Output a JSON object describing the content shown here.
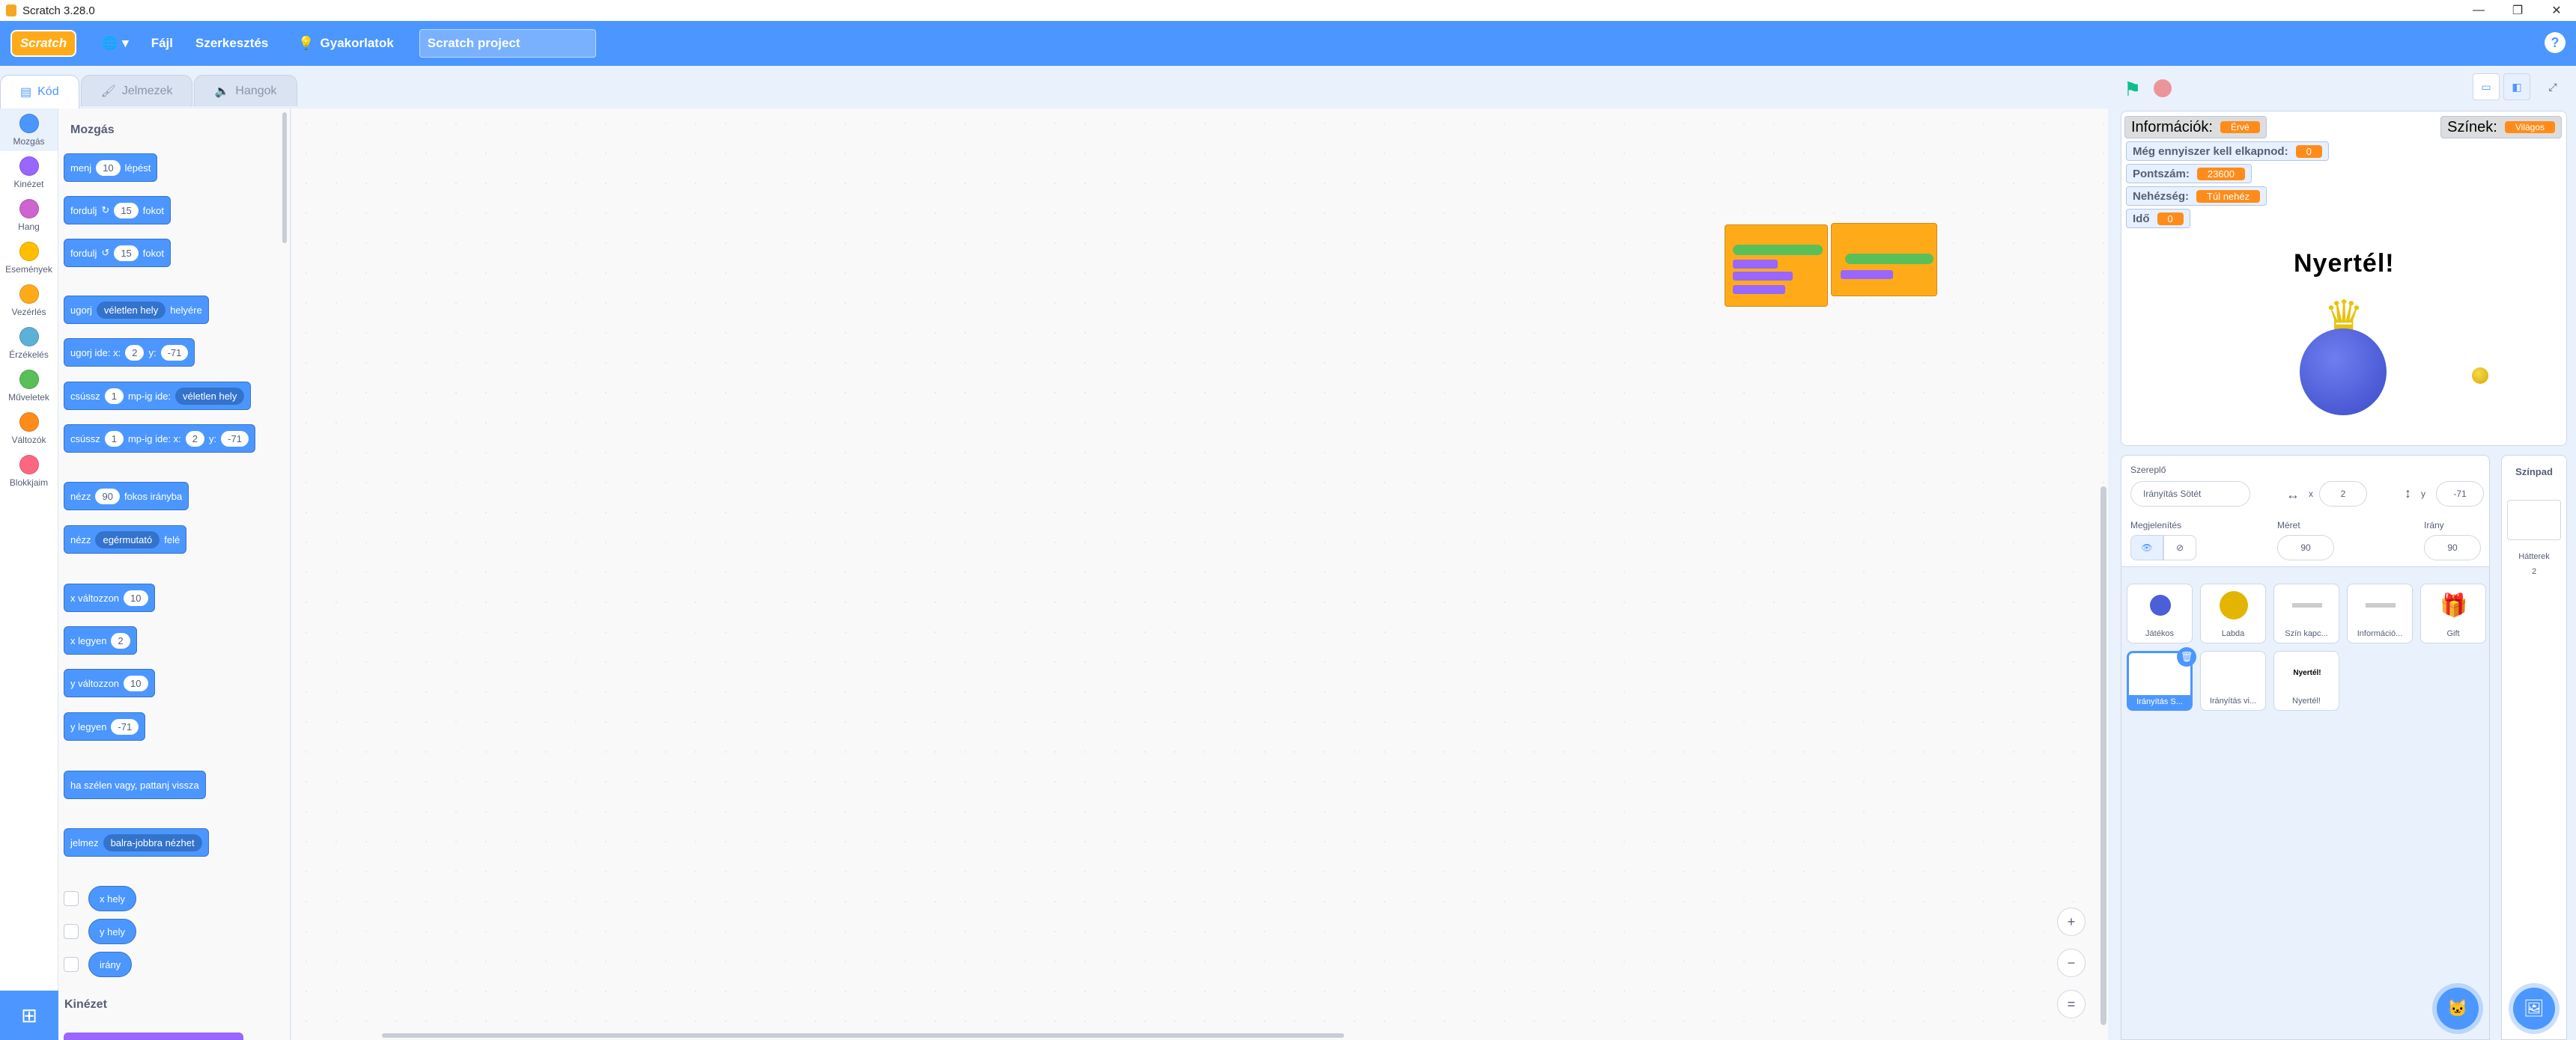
{
  "window": {
    "title": "Scratch 3.28.0",
    "buttons": [
      "—",
      "❐",
      "✕"
    ]
  },
  "menubar": {
    "logo": "Scratch",
    "file": "Fájl",
    "edit": "Szerkesztés",
    "tutorials": "Gyakorlatok",
    "project_title": "Scratch project"
  },
  "tabs": [
    {
      "label": "Kód"
    },
    {
      "label": "Jelmezek"
    },
    {
      "label": "Hangok"
    }
  ],
  "categories": [
    {
      "label": "Mozgás",
      "color": "#4c97ff"
    },
    {
      "label": "Kinézet",
      "color": "#9966ff"
    },
    {
      "label": "Hang",
      "color": "#cf63cf"
    },
    {
      "label": "Események",
      "color": "#ffbf00"
    },
    {
      "label": "Vezérlés",
      "color": "#ffab19"
    },
    {
      "label": "Érzékelés",
      "color": "#5cb1d6"
    },
    {
      "label": "Műveletek",
      "color": "#59c059"
    },
    {
      "label": "Változók",
      "color": "#ff8c1a"
    },
    {
      "label": "Blokkjaim",
      "color": "#ff6680"
    }
  ],
  "palette": {
    "section_motion": "Mozgás",
    "section_looks": "Kinézet",
    "blocks": {
      "move": {
        "a": "menj",
        "n": "10",
        "b": "lépést"
      },
      "turn_right": {
        "a": "fordulj",
        "icon": "↻",
        "n": "15",
        "b": "fokot"
      },
      "turn_left": {
        "a": "fordulj",
        "icon": "↺",
        "n": "15",
        "b": "fokot"
      },
      "goto": {
        "a": "ugorj",
        "dd": "véletlen hely",
        "b": "helyére"
      },
      "goto_xy": {
        "a": "ugorj ide: x:",
        "x": "2",
        "b": "y:",
        "y": "-71"
      },
      "glide": {
        "a": "csússz",
        "n": "1",
        "b": "mp-ig ide:",
        "dd": "véletlen hely"
      },
      "glide_xy": {
        "a": "csússz",
        "n": "1",
        "b": "mp-ig ide: x:",
        "x": "2",
        "c": "y:",
        "y": "-71"
      },
      "point": {
        "a": "nézz",
        "n": "90",
        "b": "fokos irányba"
      },
      "point_towards": {
        "a": "nézz",
        "dd": "egérmutató",
        "b": "felé"
      },
      "change_x": {
        "a": "x változzon",
        "n": "10"
      },
      "set_x": {
        "a": "x legyen",
        "n": "2"
      },
      "change_y": {
        "a": "y változzon",
        "n": "10"
      },
      "set_y": {
        "a": "y legyen",
        "n": "-71"
      },
      "bounce": {
        "a": "ha szélen vagy, pattanj vissza"
      },
      "rotation": {
        "a": "jelmez",
        "dd": "balra-jobbra nézhet"
      },
      "rep_x": "x hely",
      "rep_y": "y hely",
      "rep_dir": "irány"
    }
  },
  "zoom": {
    "in": "+",
    "out": "−",
    "reset": "="
  },
  "stage": {
    "monitors": {
      "info_label": "Információk:",
      "info_value": "Érvé",
      "colors_label": "Színek:",
      "colors_value": "Világos",
      "catch_label": "Még ennyiszer kell elkapnod:",
      "catch_value": "0",
      "score_label": "Pontszám:",
      "score_value": "23600",
      "diff_label": "Nehézség:",
      "diff_value": "Túl nehéz",
      "time_label": "Idő",
      "time_value": "0"
    },
    "win_text": "Nyertél!"
  },
  "sprite_info": {
    "sprite_label": "Szereplő",
    "sprite_name": "Irányítás Sötét",
    "x_label": "x",
    "x": "2",
    "y_label": "y",
    "y": "-71",
    "show_label": "Megjelenítés",
    "size_label": "Méret",
    "size": "90",
    "dir_label": "Irány",
    "direction": "90"
  },
  "sprites": [
    {
      "name": "Játékos"
    },
    {
      "name": "Labda"
    },
    {
      "name": "Szín kapc..."
    },
    {
      "name": "Információ..."
    },
    {
      "name": "Gift"
    },
    {
      "name": "Irányítás S..."
    },
    {
      "name": "Irányítás vi..."
    },
    {
      "name": "Nyertél!"
    }
  ],
  "stage_panel": {
    "title": "Színpad",
    "backdrops_label": "Hátterek",
    "backdrops": "2"
  },
  "colors": {
    "accent": "#4c97ff",
    "orange": "#ff8c1a"
  }
}
